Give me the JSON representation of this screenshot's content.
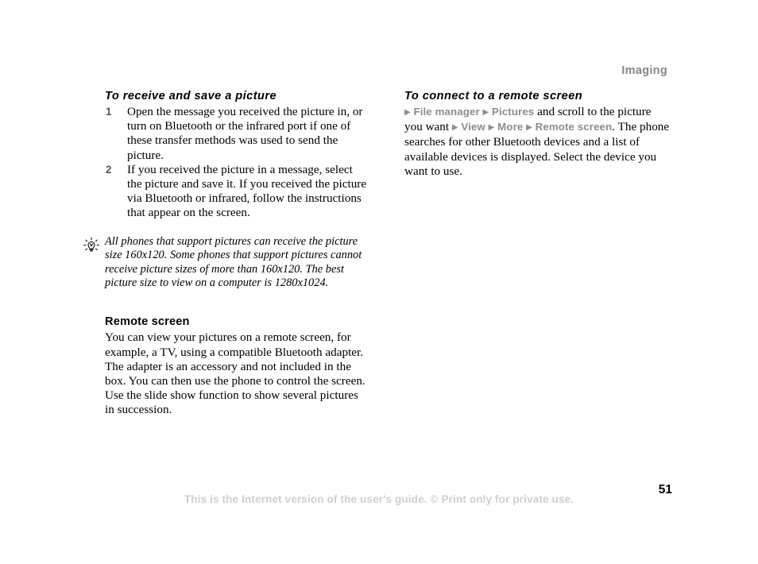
{
  "page": {
    "running_header": "Imaging",
    "page_number": "51",
    "footer_note": "This is the Internet version of the user's guide. © Print only for private use."
  },
  "left_column": {
    "procedure": {
      "heading": "To receive and save a picture",
      "steps": [
        {
          "number": "1",
          "text": "Open the message you received the picture in, or turn on Bluetooth or the infrared port if one of these transfer methods was used to send the picture."
        },
        {
          "number": "2",
          "text": "If you received the picture in a message, select the picture and save it. If you received the picture via Bluetooth or infrared, follow the instructions that appear on the screen."
        }
      ]
    },
    "tip": {
      "icon": "lightbulb-tip-icon",
      "text": "All phones that support pictures can receive the picture size 160x120. Some phones that support pictures cannot receive picture sizes of more than 160x120. The best picture size to view on a computer is 1280x1024."
    },
    "section": {
      "heading": "Remote screen",
      "body": "You can view your pictures on a remote screen, for example, a TV, using a compatible Bluetooth adapter. The adapter is an accessory and not included in the box. You can then use the phone to control the screen. Use the slide show function to show several pictures in succession."
    }
  },
  "right_column": {
    "procedure": {
      "heading": "To connect to a remote screen",
      "menu_path_1": [
        "File manager",
        "Pictures"
      ],
      "text_1": "and scroll to the picture you want",
      "menu_path_2": [
        "View",
        "More",
        "Remote screen"
      ],
      "text_2": ". The phone searches for other Bluetooth devices and a list of available devices is displayed. Select the device you want to use.",
      "arrow_glyph": "▶"
    }
  },
  "colors": {
    "page_background": "#ffffff",
    "body_text": "#000000",
    "header_gray": "#868686",
    "menu_gray": "#8c8c8c",
    "footer_gray": "#cfcfcf",
    "step_number_gray": "#555555"
  }
}
